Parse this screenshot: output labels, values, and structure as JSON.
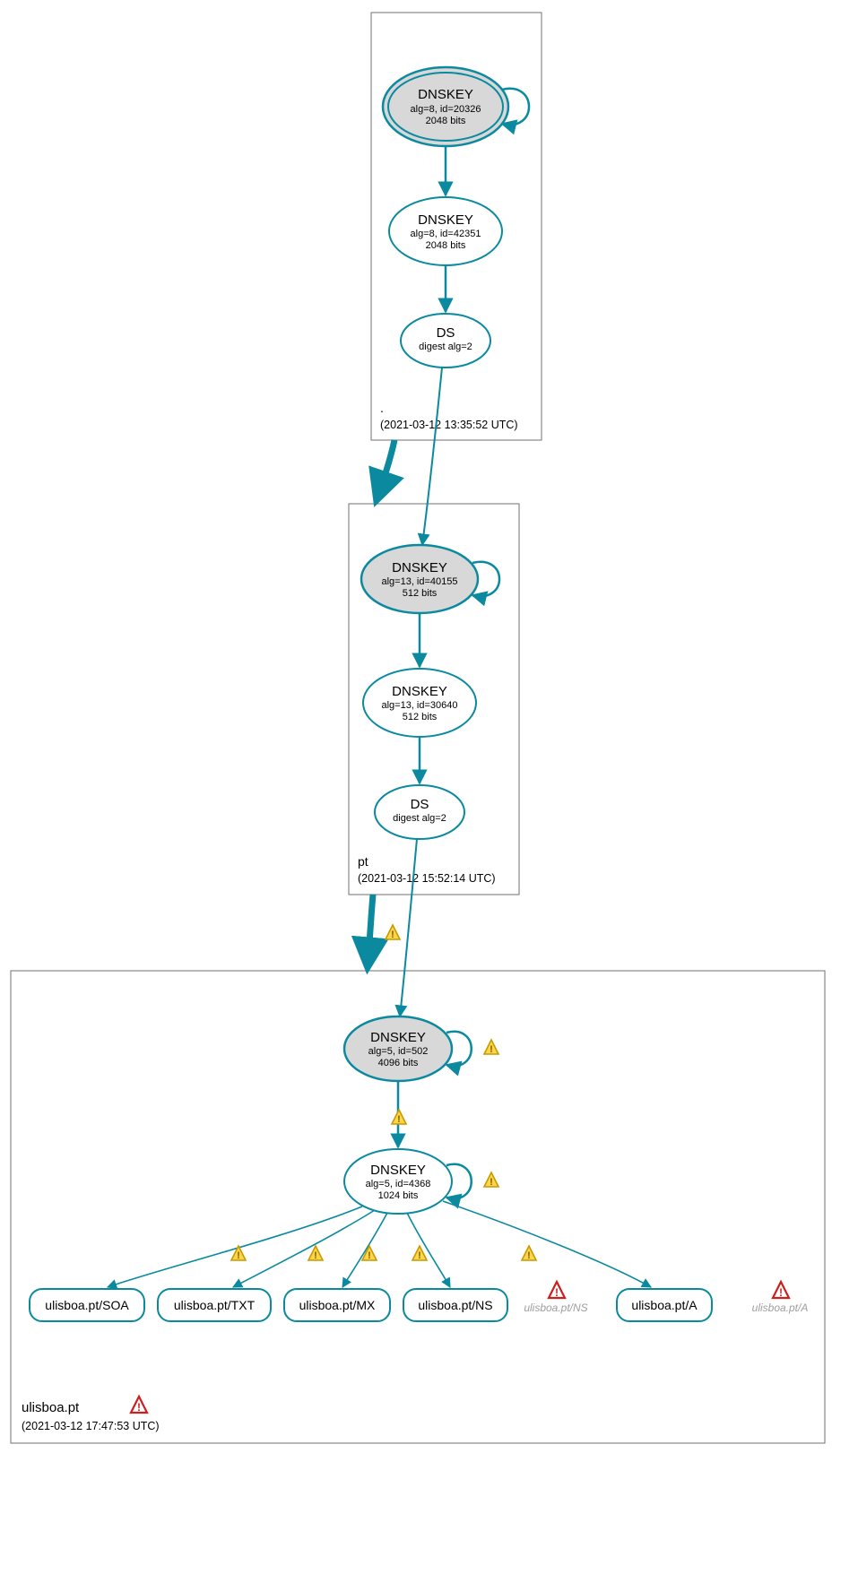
{
  "colors": {
    "teal": "#0b8a9f",
    "grayFill": "#d8d8d8",
    "boxBorder": "#707070",
    "lightText": "#aaaaaa",
    "warnFill": "#ffd54a",
    "warnStroke": "#c79a00",
    "errFill": "#ffffff",
    "errStroke": "#cc1f1f"
  },
  "zones": {
    "root": {
      "label": ".",
      "timestamp": "(2021-03-12 13:35:52 UTC)"
    },
    "pt": {
      "label": "pt",
      "timestamp": "(2021-03-12 15:52:14 UTC)"
    },
    "ulisboa": {
      "label": "ulisboa.pt",
      "timestamp": "(2021-03-12 17:47:53 UTC)"
    }
  },
  "nodes": {
    "root_ksk": {
      "title": "DNSKEY",
      "line2": "alg=8, id=20326",
      "line3": "2048 bits"
    },
    "root_zsk": {
      "title": "DNSKEY",
      "line2": "alg=8, id=42351",
      "line3": "2048 bits"
    },
    "root_ds": {
      "title": "DS",
      "line2": "digest alg=2",
      "line3": ""
    },
    "pt_ksk": {
      "title": "DNSKEY",
      "line2": "alg=13, id=40155",
      "line3": "512 bits"
    },
    "pt_zsk": {
      "title": "DNSKEY",
      "line2": "alg=13, id=30640",
      "line3": "512 bits"
    },
    "pt_ds": {
      "title": "DS",
      "line2": "digest alg=2",
      "line3": ""
    },
    "ul_ksk": {
      "title": "DNSKEY",
      "line2": "alg=5, id=502",
      "line3": "4096 bits"
    },
    "ul_zsk": {
      "title": "DNSKEY",
      "line2": "alg=5, id=4368",
      "line3": "1024 bits"
    },
    "rr_soa": {
      "label": "ulisboa.pt/SOA"
    },
    "rr_txt": {
      "label": "ulisboa.pt/TXT"
    },
    "rr_mx": {
      "label": "ulisboa.pt/MX"
    },
    "rr_ns": {
      "label": "ulisboa.pt/NS"
    },
    "rr_a": {
      "label": "ulisboa.pt/A"
    },
    "rr_ns_gray": {
      "label": "ulisboa.pt/NS"
    },
    "rr_a_gray": {
      "label": "ulisboa.pt/A"
    }
  },
  "chart_data": {
    "type": "graph",
    "description": "DNSSEC authentication chain / DNSViz-style diagram for ulisboa.pt",
    "zones": [
      {
        "name": ".",
        "timestamp": "2021-03-12 13:35:52 UTC"
      },
      {
        "name": "pt",
        "timestamp": "2021-03-12 15:52:14 UTC"
      },
      {
        "name": "ulisboa.pt",
        "timestamp": "2021-03-12 17:47:53 UTC"
      }
    ],
    "nodes": [
      {
        "id": "root_ksk",
        "zone": ".",
        "type": "DNSKEY",
        "alg": 8,
        "key_id": 20326,
        "bits": 2048,
        "trust_anchor": true
      },
      {
        "id": "root_zsk",
        "zone": ".",
        "type": "DNSKEY",
        "alg": 8,
        "key_id": 42351,
        "bits": 2048
      },
      {
        "id": "root_ds",
        "zone": ".",
        "type": "DS",
        "digest_alg": 2
      },
      {
        "id": "pt_ksk",
        "zone": "pt",
        "type": "DNSKEY",
        "alg": 13,
        "key_id": 40155,
        "bits": 512,
        "sep": true
      },
      {
        "id": "pt_zsk",
        "zone": "pt",
        "type": "DNSKEY",
        "alg": 13,
        "key_id": 30640,
        "bits": 512
      },
      {
        "id": "pt_ds",
        "zone": "pt",
        "type": "DS",
        "digest_alg": 2
      },
      {
        "id": "ul_ksk",
        "zone": "ulisboa.pt",
        "type": "DNSKEY",
        "alg": 5,
        "key_id": 502,
        "bits": 4096,
        "sep": true,
        "status": "warning"
      },
      {
        "id": "ul_zsk",
        "zone": "ulisboa.pt",
        "type": "DNSKEY",
        "alg": 5,
        "key_id": 4368,
        "bits": 1024,
        "status": "warning"
      },
      {
        "id": "rr_soa",
        "zone": "ulisboa.pt",
        "type": "RRset",
        "name": "ulisboa.pt/SOA"
      },
      {
        "id": "rr_txt",
        "zone": "ulisboa.pt",
        "type": "RRset",
        "name": "ulisboa.pt/TXT"
      },
      {
        "id": "rr_mx",
        "zone": "ulisboa.pt",
        "type": "RRset",
        "name": "ulisboa.pt/MX"
      },
      {
        "id": "rr_ns",
        "zone": "ulisboa.pt",
        "type": "RRset",
        "name": "ulisboa.pt/NS"
      },
      {
        "id": "rr_a",
        "zone": "ulisboa.pt",
        "type": "RRset",
        "name": "ulisboa.pt/A"
      },
      {
        "id": "rr_ns_gray",
        "zone": "ulisboa.pt",
        "type": "RRset",
        "name": "ulisboa.pt/NS",
        "insecure": true,
        "status": "error"
      },
      {
        "id": "rr_a_gray",
        "zone": "ulisboa.pt",
        "type": "RRset",
        "name": "ulisboa.pt/A",
        "insecure": true,
        "status": "error"
      }
    ],
    "edges": [
      {
        "from": "root_ksk",
        "to": "root_ksk",
        "kind": "self-sign"
      },
      {
        "from": "root_ksk",
        "to": "root_zsk"
      },
      {
        "from": "root_zsk",
        "to": "root_ds"
      },
      {
        "from": "root_ds",
        "to": "pt_ksk"
      },
      {
        "from": ".",
        "to": "pt",
        "kind": "delegation"
      },
      {
        "from": "pt_ksk",
        "to": "pt_ksk",
        "kind": "self-sign"
      },
      {
        "from": "pt_ksk",
        "to": "pt_zsk"
      },
      {
        "from": "pt_zsk",
        "to": "pt_ds"
      },
      {
        "from": "pt_ds",
        "to": "ul_ksk"
      },
      {
        "from": "pt",
        "to": "ulisboa.pt",
        "kind": "delegation",
        "status": "warning"
      },
      {
        "from": "ul_ksk",
        "to": "ul_ksk",
        "kind": "self-sign",
        "status": "warning"
      },
      {
        "from": "ul_ksk",
        "to": "ul_zsk",
        "status": "warning"
      },
      {
        "from": "ul_zsk",
        "to": "ul_zsk",
        "kind": "self-sign",
        "status": "warning"
      },
      {
        "from": "ul_zsk",
        "to": "rr_soa",
        "status": "warning"
      },
      {
        "from": "ul_zsk",
        "to": "rr_txt",
        "status": "warning"
      },
      {
        "from": "ul_zsk",
        "to": "rr_mx",
        "status": "warning"
      },
      {
        "from": "ul_zsk",
        "to": "rr_ns",
        "status": "warning"
      },
      {
        "from": "ul_zsk",
        "to": "rr_a",
        "status": "warning"
      }
    ],
    "zone_status": {
      "ulisboa.pt": "error"
    }
  }
}
